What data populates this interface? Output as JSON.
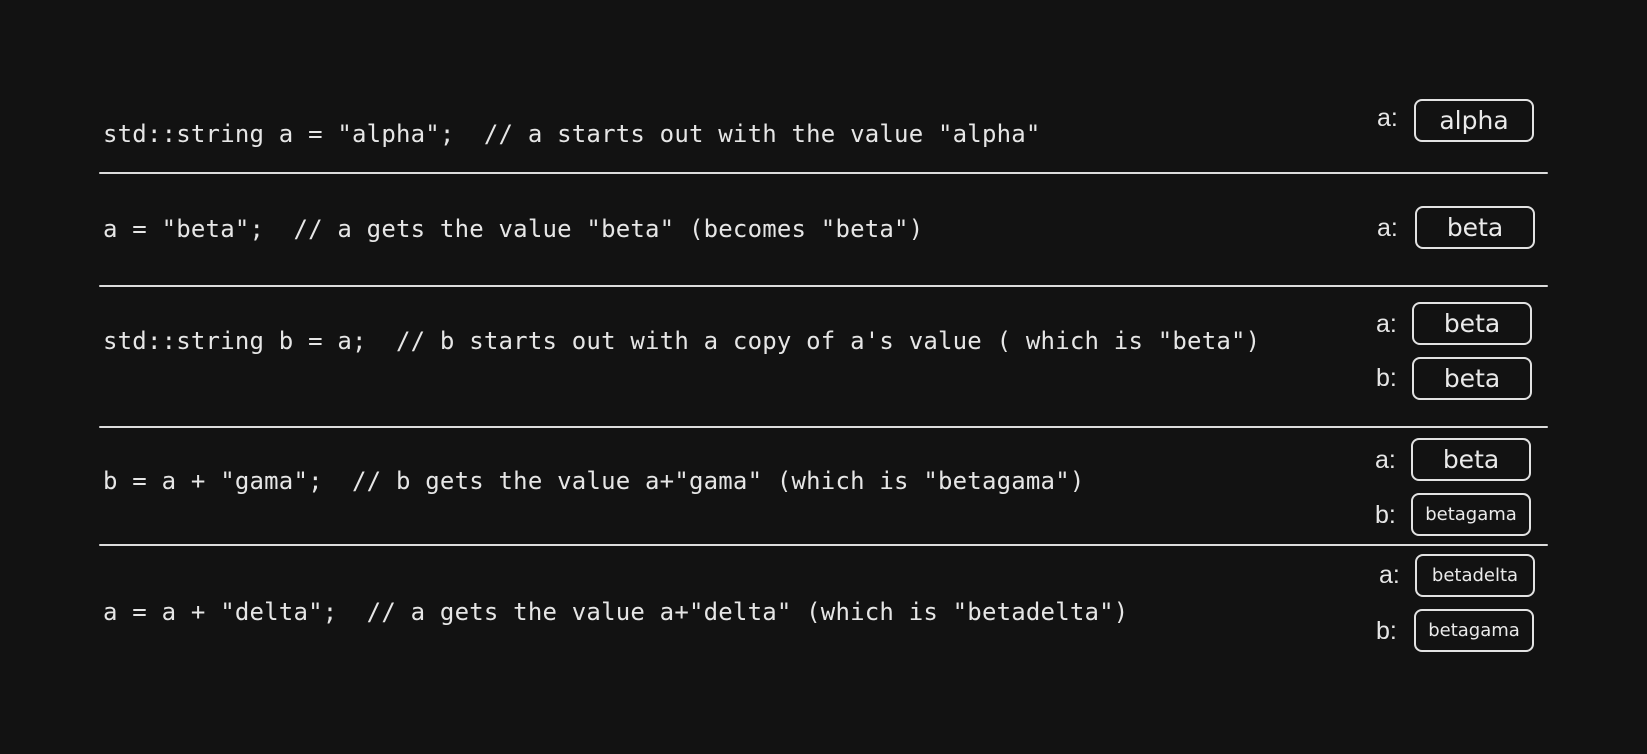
{
  "rows": [
    {
      "code": "std::string a = \"alpha\";  // a starts out with the value \"alpha\"",
      "vars": [
        {
          "label": "a:",
          "value": "alpha"
        }
      ]
    },
    {
      "code": "a = \"beta\";  // a gets the value \"beta\" (becomes \"beta\")",
      "vars": [
        {
          "label": "a:",
          "value": "beta"
        }
      ]
    },
    {
      "code": "std::string b = a;  // b starts out with a copy of a's value ( which is \"beta\")",
      "vars": [
        {
          "label": "a:",
          "value": "beta"
        },
        {
          "label": "b:",
          "value": "beta"
        }
      ]
    },
    {
      "code": "b = a + \"gama\";  // b gets the value a+\"gama\" (which is \"betagama\")",
      "vars": [
        {
          "label": "a:",
          "value": "beta"
        },
        {
          "label": "b:",
          "value": "betagama"
        }
      ]
    },
    {
      "code": "a = a + \"delta\";  // a gets the value a+\"delta\" (which is \"betadelta\")",
      "vars": [
        {
          "label": "a:",
          "value": "betadelta"
        },
        {
          "label": "b:",
          "value": "betagama"
        }
      ]
    }
  ]
}
